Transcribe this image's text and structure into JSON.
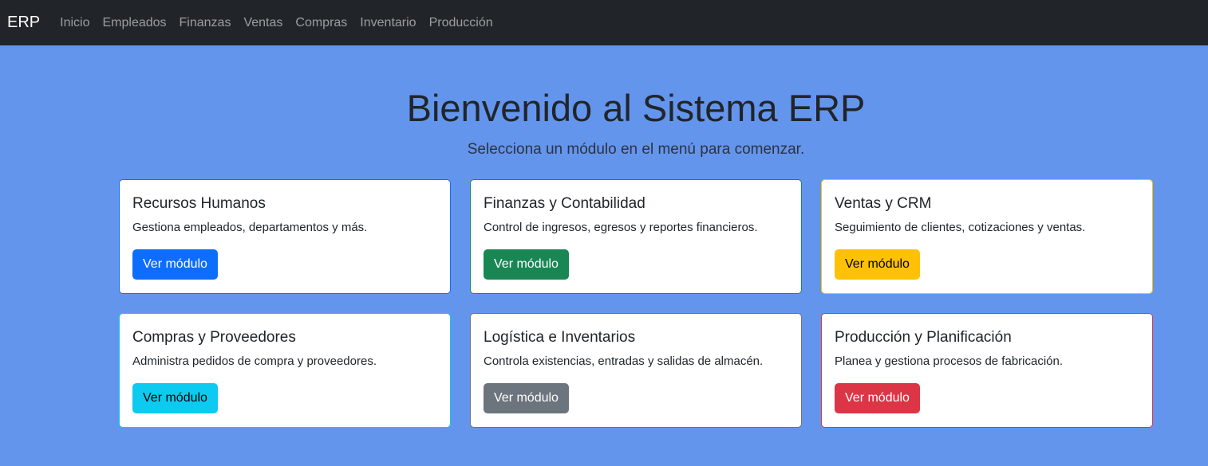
{
  "navbar": {
    "brand": "ERP",
    "links": [
      "Inicio",
      "Empleados",
      "Finanzas",
      "Ventas",
      "Compras",
      "Inventario",
      "Producción"
    ]
  },
  "hero": {
    "title": "Bienvenido al Sistema ERP",
    "subtitle": "Selecciona un módulo en el menú para comenzar."
  },
  "cards": [
    {
      "title": "Recursos Humanos",
      "text": "Gestiona empleados, departamentos y más.",
      "button": "Ver módulo",
      "border": "#0d6efd",
      "btn_bg": "#0d6efd",
      "btn_fg": "#ffffff"
    },
    {
      "title": "Finanzas y Contabilidad",
      "text": "Control de ingresos, egresos y reportes financieros.",
      "button": "Ver módulo",
      "border": "#198754",
      "btn_bg": "#198754",
      "btn_fg": "#ffffff"
    },
    {
      "title": "Ventas y CRM",
      "text": "Seguimiento de clientes, cotizaciones y ventas.",
      "button": "Ver módulo",
      "border": "#ffc107",
      "btn_bg": "#ffc107",
      "btn_fg": "#000000"
    },
    {
      "title": "Compras y Proveedores",
      "text": "Administra pedidos de compra y proveedores.",
      "button": "Ver módulo",
      "border": "#0dcaf0",
      "btn_bg": "#0dcaf0",
      "btn_fg": "#000000"
    },
    {
      "title": "Logística e Inventarios",
      "text": "Controla existencias, entradas y salidas de almacén.",
      "button": "Ver módulo",
      "border": "#6c757d",
      "btn_bg": "#6c757d",
      "btn_fg": "#ffffff"
    },
    {
      "title": "Producción y Planificación",
      "text": "Planea y gestiona procesos de fabricación.",
      "button": "Ver módulo",
      "border": "#dc3545",
      "btn_bg": "#dc3545",
      "btn_fg": "#ffffff"
    }
  ]
}
